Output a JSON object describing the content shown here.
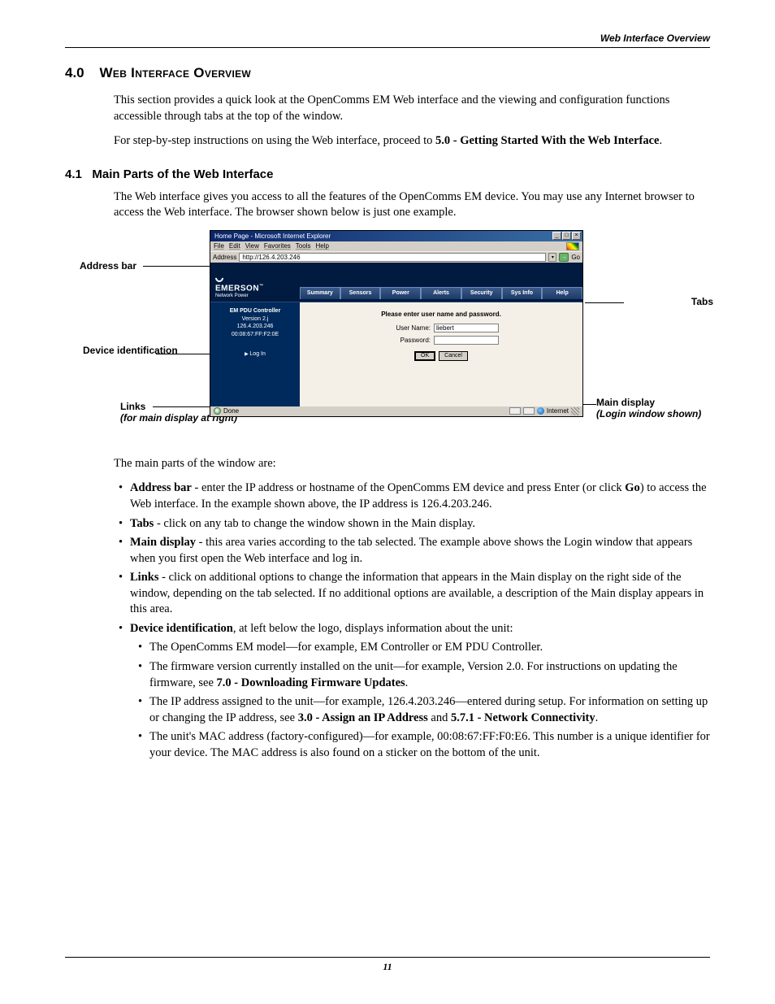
{
  "header": {
    "running_title": "Web Interface Overview"
  },
  "section": {
    "number": "4.0",
    "title": "Web Interface Overview",
    "para1": "This section provides a quick look at the OpenComms EM Web interface and the viewing and configuration functions accessible through tabs at the top of the window.",
    "para2_pre": "For step-by-step instructions on using the Web interface, proceed to ",
    "para2_ref": "5.0 - Getting Started With the Web Interface",
    "para2_post": "."
  },
  "subsection": {
    "number": "4.1",
    "title": "Main Parts of the Web Interface",
    "intro": "The Web interface gives you access to all the features of the OpenComms EM device. You may use any Internet browser to access the Web interface. The browser shown below is just one example."
  },
  "callouts": {
    "address_bar": "Address bar",
    "tabs": "Tabs",
    "device_id": "Device identification",
    "links": "Links",
    "links_sub": "(for main display at right)",
    "main_display": "Main display",
    "main_display_sub": "(Login window shown)"
  },
  "ie": {
    "title": "Home Page - Microsoft Internet Explorer",
    "minimize": "_",
    "maximize": "□",
    "close": "×",
    "menu": {
      "file": "File",
      "edit": "Edit",
      "view": "View",
      "favorites": "Favorites",
      "tools": "Tools",
      "help": "Help"
    },
    "addr_label": "Address",
    "addr_value": "http://126.4.203.246",
    "go_label": "Go",
    "dropdown_glyph": "▾",
    "go_glyph": "→",
    "brand": "EMERSON",
    "brand_tm": "™",
    "brand_sub": "Network Power",
    "tabs": [
      "Summary",
      "Sensors",
      "Power",
      "Alerts",
      "Security",
      "Sys Info",
      "Help"
    ],
    "side": {
      "line1": "EM PDU Controller",
      "line2": "Version 2.j",
      "line3": "126.4.203.246",
      "line4": "00:08:67:FF:F2:0E",
      "login": "Log In"
    },
    "form": {
      "prompt": "Please enter user name and password.",
      "user_label": "User Name:",
      "user_value": "liebert",
      "pass_label": "Password:",
      "ok": "OK",
      "cancel": "Cancel"
    },
    "status": {
      "done": "Done",
      "zone": "Internet"
    }
  },
  "after_figure_lead": "The main parts of the window are:",
  "bullets": {
    "addr": {
      "term": "Address bar",
      "rest": " - enter the IP address or hostname of the OpenComms EM device and press Enter (or click ",
      "go": "Go",
      "rest2": ") to access the Web interface. In the example shown above, the IP address is 126.4.203.246."
    },
    "tabs": {
      "term": "Tabs",
      "rest": " - click on any tab to change the window shown in the Main display."
    },
    "main": {
      "term": "Main display",
      "rest": " - this area varies according to the tab selected. The example above shows the Login window that appears when you first open the Web interface and log in."
    },
    "links": {
      "term": "Links",
      "rest": " - click on additional options to change the information that appears in the Main display on the right side of the window, depending on the tab selected. If no additional options are available, a description of the Main display appears in this area."
    },
    "devid": {
      "term": "Device identification",
      "rest": ", at left below the logo, displays information about the unit:",
      "sub1": "The OpenComms EM model—for example, EM Controller or EM PDU Controller.",
      "sub2_pre": "The firmware version currently installed on the unit—for example, Version 2.0. For instructions on updating the firmware, see ",
      "sub2_ref": "7.0 - Downloading Firmware Updates",
      "sub2_post": ".",
      "sub3_pre": "The IP address assigned to the unit—for example, 126.4.203.246—entered during setup. For information on setting up or changing the IP address, see ",
      "sub3_ref1": "3.0 - Assign an IP Address",
      "sub3_mid": " and ",
      "sub3_ref2": "5.7.1 - Network Connectivity",
      "sub3_post": ".",
      "sub4": "The unit's MAC address (factory-configured)—for example, 00:08:67:FF:F0:E6. This number is a unique identifier for your device. The MAC address is also found on a sticker on the bottom of the unit."
    }
  },
  "page_number": "11"
}
